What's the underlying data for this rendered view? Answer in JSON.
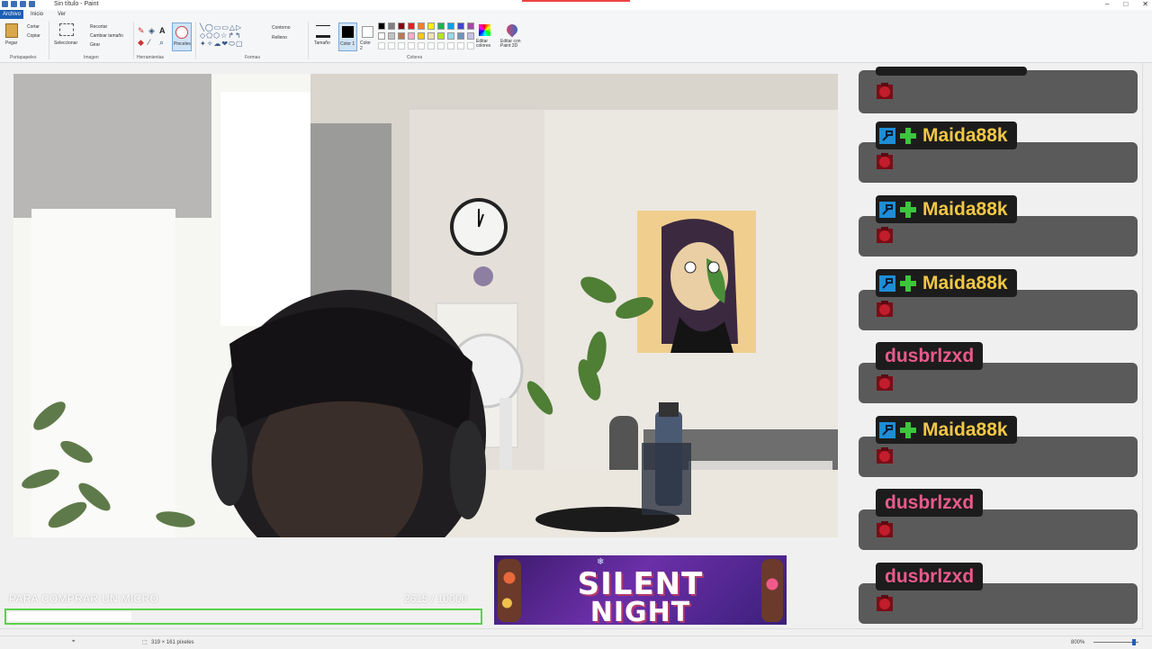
{
  "window": {
    "title": "Sin título - Paint",
    "minimize": "–",
    "maximize": "□",
    "close": "✕"
  },
  "menu": {
    "file": "Archivo",
    "tabs": [
      "Inicio",
      "Ver"
    ]
  },
  "ribbon": {
    "clipboard": {
      "paste": "Pegar",
      "cut": "Cortar",
      "copy": "Copiar",
      "label": "Portapapeles"
    },
    "image": {
      "select": "Seleccionar",
      "crop": "Recortar",
      "resize": "Cambiar tamaño",
      "rotate": "Girar",
      "label": "Imagen"
    },
    "tools": {
      "brushes": "Pinceles",
      "label": "Herramientas"
    },
    "shapes": {
      "outline": "Contorno",
      "fill": "Relleno",
      "label": "Formas"
    },
    "size": "Tamaño",
    "color1": "Color 1",
    "color2": "Color 2",
    "edit_colors": "Editar colores",
    "paint3d": "Editar con Paint 3D",
    "colors_label": "Colores",
    "palette": [
      "#000000",
      "#7f7f7f",
      "#880015",
      "#ed1c24",
      "#ff7f27",
      "#fff200",
      "#22b14c",
      "#00a2e8",
      "#3f48cc",
      "#a349a4",
      "#ffffff",
      "#c3c3c3",
      "#b97a57",
      "#ffaec9",
      "#ffc90e",
      "#efe4b0",
      "#b5e61d",
      "#99d9ea",
      "#7092be",
      "#c8bfe7"
    ]
  },
  "chat": {
    "colors": {
      "maida": "#f2c744",
      "dusbr": "#ea5a8c"
    },
    "messages": [
      {
        "user": "",
        "badges": false,
        "color": "maida"
      },
      {
        "user": "Maida88k",
        "badges": true,
        "color": "maida"
      },
      {
        "user": "Maida88k",
        "badges": true,
        "color": "maida"
      },
      {
        "user": "Maida88k",
        "badges": true,
        "color": "maida"
      },
      {
        "user": "dusbrlzxd",
        "badges": false,
        "color": "dusbr"
      },
      {
        "user": "Maida88k",
        "badges": true,
        "color": "maida"
      },
      {
        "user": "dusbrlzxd",
        "badges": false,
        "color": "dusbr"
      },
      {
        "user": "dusbrlzxd",
        "badges": false,
        "color": "dusbr"
      }
    ]
  },
  "goal": {
    "label": "PARA COMPRAR UN MICRO",
    "current": "2615",
    "target": "10000",
    "progress_text": "2615  / 10000",
    "progress_fraction": 0.2615,
    "bar_color": "#5ad24a"
  },
  "banner": {
    "line1": "SILENT",
    "line2": "NIGHT"
  },
  "statusbar": {
    "cursor_pos": "",
    "selection_size": "319 × 161 píxeles",
    "zoom": "800%"
  }
}
